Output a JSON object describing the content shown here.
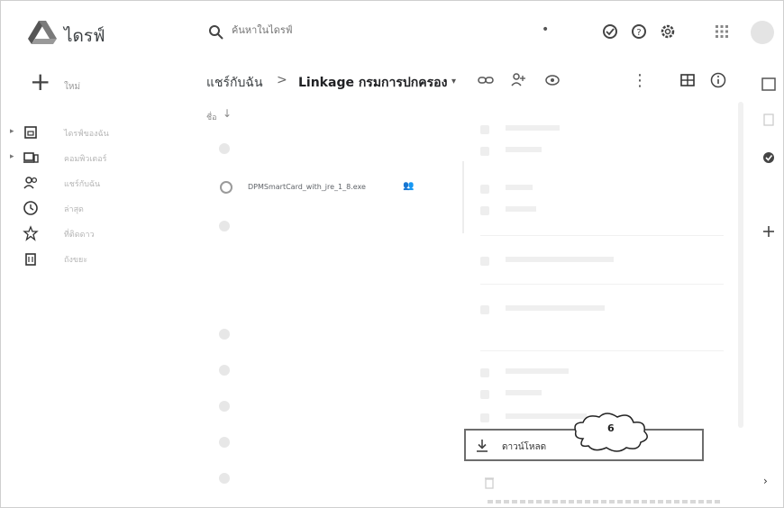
{
  "app": {
    "title": "ไดรฟ์"
  },
  "search": {
    "placeholder": "ค้นหาในไดรฟ์"
  },
  "sidebar": {
    "new_label": "ใหม่",
    "items": [
      {
        "label": "ไดรฟ์ของฉัน",
        "icon": "my-drive-icon"
      },
      {
        "label": "คอมพิวเตอร์",
        "icon": "computer-icon"
      },
      {
        "label": "แชร์กับฉัน",
        "icon": "shared-with-me-icon"
      },
      {
        "label": "ล่าสุด",
        "icon": "clock-icon"
      },
      {
        "label": "ที่ติดดาว",
        "icon": "star-icon"
      },
      {
        "label": "ถังขยะ",
        "icon": "trash-icon"
      }
    ]
  },
  "breadcrumb": {
    "root": "แชร์กับฉัน",
    "separator": ">",
    "current": "Linkage กรมการปกครอง"
  },
  "file_list": {
    "header": "ชื่อ",
    "files": [
      {
        "name": "DPMSmartCard_with_jre_1_8.exe"
      }
    ]
  },
  "context_menu": {
    "download_label": "ดาวน์โหลด"
  },
  "annotation": {
    "step": "6"
  },
  "colors": {
    "accent": "#6d6d6d",
    "text": "#3c4043"
  }
}
